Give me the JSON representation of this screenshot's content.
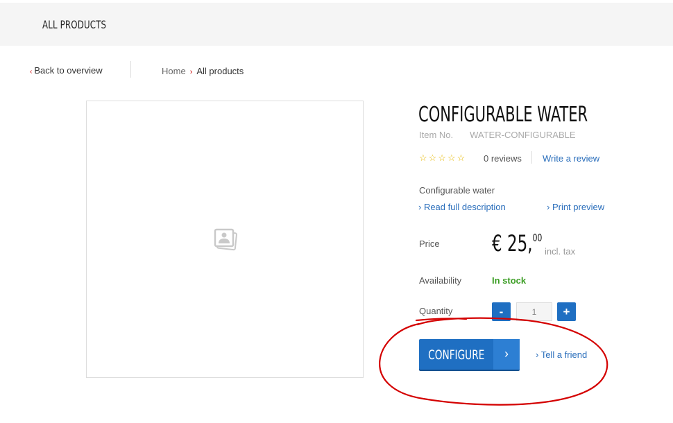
{
  "header": {
    "title": "ALL PRODUCTS"
  },
  "nav": {
    "back_chevron": "‹",
    "back_label": "Back to overview",
    "breadcrumb": [
      {
        "label": "Home"
      },
      {
        "label": "All products"
      }
    ],
    "breadcrumb_sep": "›"
  },
  "image": {
    "icon": "image-placeholder-icon"
  },
  "product": {
    "title": "CONFIGURABLE WATER",
    "item_no_label": "Item No.",
    "item_no": "WATER-CONFIGURABLE",
    "stars": "☆☆☆☆☆",
    "rating": 0,
    "reviews": "0 reviews",
    "write_review": "Write a review",
    "short_description": "Configurable water",
    "read_full": "› Read full description",
    "print_preview": "› Print preview",
    "price_label": "Price",
    "price_main": "€ 25,",
    "price_cents": "00",
    "price_tax": "incl. tax",
    "availability_label": "Availability",
    "availability": "In stock",
    "availability_color": "#3a9d23",
    "quantity_label": "Quantity",
    "quantity": "1",
    "minus": "-",
    "plus": "+",
    "configure": "CONFIGURE",
    "configure_arrow": "›",
    "tell_friend": "› Tell a friend",
    "accent_color": "#1f6fc2"
  }
}
